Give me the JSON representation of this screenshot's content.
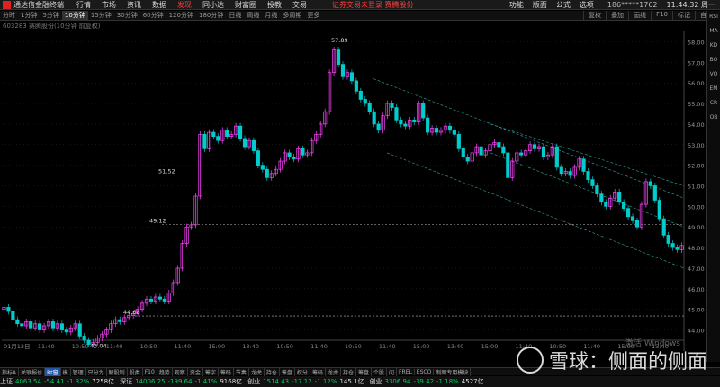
{
  "titlebar": {
    "app_name": "通达信金融终端",
    "menus": [
      "行情",
      "市场",
      "资讯",
      "数据",
      "发现",
      "同小达",
      "财富圈",
      "投教",
      "交易"
    ],
    "hot_menu_index": 4,
    "notice": "证券交易未登录  赛腾股份",
    "right_items": [
      "功能",
      "版面",
      "公式",
      "选项"
    ],
    "phone": "186*****1762",
    "clock": "11:44:32 周一"
  },
  "periodbar": {
    "periods": [
      "分时",
      "1分钟",
      "5分钟",
      "10分钟",
      "15分钟",
      "30分钟",
      "60分钟",
      "120分钟",
      "180分钟",
      "日线",
      "周线",
      "月线",
      "多周期",
      "更多"
    ],
    "active_index": 3,
    "right_tabs": [
      "复权",
      "叠加",
      "画线",
      "F10",
      "标记",
      "自选"
    ]
  },
  "stock_header": "603283 赛腾股份(10分钟 前复权)",
  "chart_data": {
    "type": "candlestick",
    "ylim": [
      43.5,
      58.5
    ],
    "y_ticks": [
      44.0,
      45.0,
      46.0,
      47.0,
      48.0,
      49.0,
      50.0,
      51.0,
      52.0,
      53.0,
      54.0,
      55.0,
      56.0,
      57.0,
      58.0
    ],
    "x_tick_labels": [
      "01月12日",
      "11:40",
      "10:50",
      "11:40",
      "10:50",
      "11:40",
      "15:00",
      "13:40",
      "10:50",
      "11:40",
      "10:50",
      "11:40",
      "15:00",
      "13:40",
      "15:00",
      "11:40",
      "10:50",
      "11:40",
      "15:00",
      "13:40"
    ],
    "price_labels": [
      {
        "text": "57.89",
        "value": 57.89
      },
      {
        "text": "51.52",
        "value": 51.52
      },
      {
        "text": "49.12",
        "value": 49.12
      },
      {
        "text": "44.68",
        "value": 44.68
      },
      {
        "text": "43.04",
        "value": 43.04
      }
    ],
    "h_levels": [
      51.52,
      49.12,
      44.68
    ],
    "closes": [
      45.1,
      44.9,
      44.5,
      44.3,
      44.2,
      44.4,
      44.1,
      44.3,
      44.0,
      44.2,
      44.4,
      44.1,
      44.3,
      44.0,
      43.9,
      44.1,
      44.3,
      43.7,
      43.5,
      43.3,
      43.4,
      43.6,
      43.8,
      44.0,
      44.3,
      44.5,
      44.4,
      44.6,
      44.7,
      44.8,
      45.0,
      45.3,
      45.5,
      45.4,
      45.6,
      45.5,
      45.4,
      45.8,
      46.3,
      47.0,
      48.2,
      49.0,
      49.1,
      50.5,
      53.5,
      52.8,
      53.6,
      53.4,
      53.2,
      53.7,
      53.4,
      53.5,
      53.9,
      53.3,
      52.9,
      53.2,
      52.7,
      52.0,
      51.8,
      51.4,
      51.6,
      51.8,
      52.2,
      52.6,
      52.4,
      52.3,
      52.8,
      52.5,
      52.6,
      53.2,
      53.5,
      54.0,
      54.6,
      56.5,
      57.6,
      56.9,
      56.3,
      56.5,
      56.1,
      55.6,
      55.2,
      55.0,
      54.6,
      54.0,
      53.7,
      54.4,
      55.0,
      54.8,
      54.2,
      54.0,
      53.9,
      54.2,
      54.1,
      55.0,
      54.3,
      53.6,
      53.8,
      53.6,
      53.7,
      53.9,
      53.7,
      53.5,
      52.8,
      52.4,
      52.2,
      52.6,
      52.9,
      52.5,
      52.7,
      53.0,
      53.1,
      52.9,
      52.6,
      51.4,
      52.2,
      52.6,
      52.5,
      52.7,
      53.0,
      52.8,
      52.9,
      52.4,
      52.5,
      52.9,
      51.9,
      51.6,
      51.7,
      51.5,
      51.9,
      52.3,
      51.7,
      51.3,
      51.0,
      50.6,
      50.2,
      50.0,
      50.4,
      50.7,
      50.2,
      49.9,
      49.5,
      49.3,
      49.0,
      50.1,
      51.2,
      51.0,
      50.3,
      49.4,
      48.6,
      48.2,
      48.0,
      47.9,
      48.1
    ]
  },
  "bottom_tabs": [
    "指标A",
    "关联报价",
    "Bt窗",
    "模",
    "管理",
    "只分为",
    "解股制",
    "股类",
    "F10",
    "趋势",
    "观察",
    "资金",
    "筹字",
    "筹码",
    "节奏",
    "龙虎",
    "持仓",
    "筹盘",
    "权分",
    "筹码",
    "龙虎",
    "持仓",
    "筹盘",
    "个股",
    "问",
    "FREL",
    "ESCO",
    "制图专用模块"
  ],
  "bottom_active_index": 2,
  "index_bar": [
    {
      "name": "上证",
      "value": "4063.54",
      "chg": "-54.41",
      "pct": "-1.32%",
      "amt": "7258亿"
    },
    {
      "name": "深证",
      "value": "14006.25",
      "chg": "-199.64",
      "pct": "-1.41%",
      "amt": "9168亿"
    },
    {
      "name": "创业",
      "value": "1514.43",
      "chg": "-17.12",
      "pct": "-1.12%",
      "amt": "145.1亿"
    },
    {
      "name": "创业",
      "value": "3306.94",
      "chg": "-39.42",
      "pct": "-1.18%",
      "amt": "4527亿"
    }
  ],
  "right_toolbar": [
    "RSI",
    "MA",
    "KD",
    "BO",
    "VO",
    "EM",
    "CR",
    "OB"
  ],
  "watermark": "雪球：侧面的侧面",
  "windows_hint": "激活 Windows",
  "colors": {
    "up": "#ff44ff",
    "down": "#00cccc",
    "grid": "#2a2a2a",
    "level_line": "#bbbbbb",
    "channel": "#2f8f8f"
  }
}
